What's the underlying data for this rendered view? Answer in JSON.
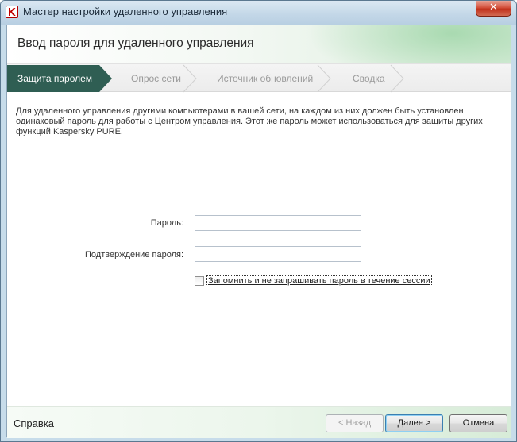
{
  "window": {
    "title": "Мастер настройки удаленного управления",
    "close_glyph": "✕",
    "app_icon": "kaspersky-k-icon",
    "close_icon": "close-icon"
  },
  "header": {
    "title": "Ввод пароля для удаленного управления"
  },
  "steps": [
    {
      "label": "Защита паролем",
      "active": true
    },
    {
      "label": "Опрос сети",
      "active": false
    },
    {
      "label": "Источник обновлений",
      "active": false
    },
    {
      "label": "Сводка",
      "active": false
    }
  ],
  "content": {
    "description": "Для удаленного управления другими компьютерами в вашей сети, на каждом из них должен быть установлен одинаковый пароль для работы с Центром управления. Этот же пароль может использоваться для защиты других функций Kaspersky PURE.",
    "password_label": "Пароль:",
    "password_value": "",
    "confirm_label": "Подтверждение пароля:",
    "confirm_value": "",
    "remember_label": "Запомнить и не запрашивать пароль в течение сессии",
    "remember_checked": false
  },
  "footer": {
    "help_label": "Справка",
    "back_label": "< Назад",
    "next_label": "Далее >",
    "cancel_label": "Отмена"
  },
  "colors": {
    "active_step": "#2f5e53",
    "accent_green": "#d7ecd8",
    "brand_red": "#b50000"
  }
}
